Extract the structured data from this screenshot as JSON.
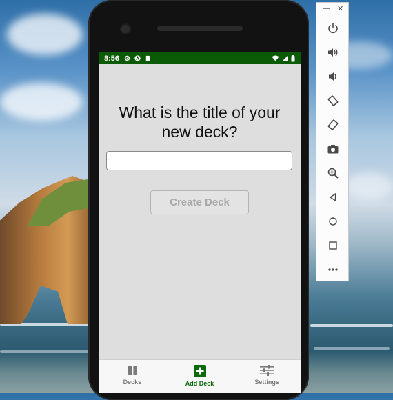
{
  "status_bar": {
    "time": "8:56",
    "left_icons": [
      "gear-icon",
      "a-circle-icon",
      "sd-card-icon"
    ],
    "right_icons": [
      "wifi-icon",
      "signal-icon",
      "battery-icon"
    ],
    "color": "#0b5a06"
  },
  "screen": {
    "title_line1": "What is the title of your",
    "title_line2": "new deck?",
    "input_value": "",
    "input_placeholder": "",
    "create_button": "Create Deck"
  },
  "tabs": [
    {
      "label": "Decks",
      "icon": "book-icon",
      "active": false
    },
    {
      "label": "Add Deck",
      "icon": "plus-box-icon",
      "active": true
    },
    {
      "label": "Settings",
      "icon": "sliders-icon",
      "active": false
    }
  ],
  "emulator_toolbar": {
    "window_controls": [
      "minimize",
      "close"
    ],
    "buttons": [
      "power-icon",
      "volume-up-icon",
      "volume-down-icon",
      "rotate-left-icon",
      "rotate-right-icon",
      "camera-icon",
      "zoom-icon",
      "back-icon",
      "home-icon",
      "overview-icon",
      "more-icon"
    ]
  },
  "colors": {
    "accent": "#0b6a0b",
    "screen_bg": "#dedede",
    "inactive_tab": "#7a7a7a"
  }
}
